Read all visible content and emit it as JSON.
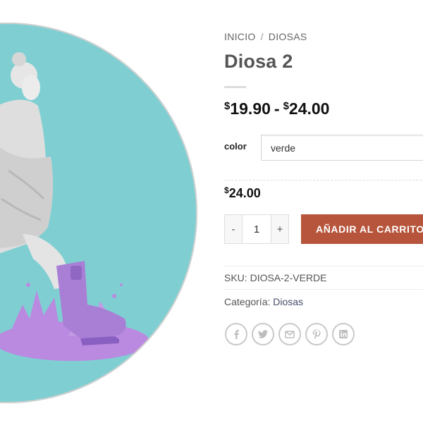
{
  "breadcrumb": {
    "home": "INICIO",
    "separator": "/",
    "category": "DIOSAS"
  },
  "product": {
    "title": "Diosa 2",
    "price_range": {
      "currency": "$",
      "min": "19.90",
      "separator": "-",
      "max": "24.00"
    },
    "variation": {
      "label": "color",
      "selected": "verde"
    },
    "variation_price": {
      "currency": "$",
      "amount": "24.00"
    },
    "quantity": {
      "minus": "-",
      "value": "1",
      "plus": "+"
    },
    "add_to_cart_label": "AÑADIR AL CARRITO",
    "sku_label": "SKU:",
    "sku_value": "DIOSA-2-VERDE",
    "category_label": "Categoría:",
    "category_value": "Diosas"
  },
  "share_icons": [
    "facebook-icon",
    "twitter-icon",
    "email-icon",
    "pinterest-icon",
    "linkedin-icon"
  ],
  "colors": {
    "image_background": "#7fcfd2",
    "button": "#b6553b",
    "boot_purple": "#a97fd6",
    "link": "#444d6b"
  }
}
